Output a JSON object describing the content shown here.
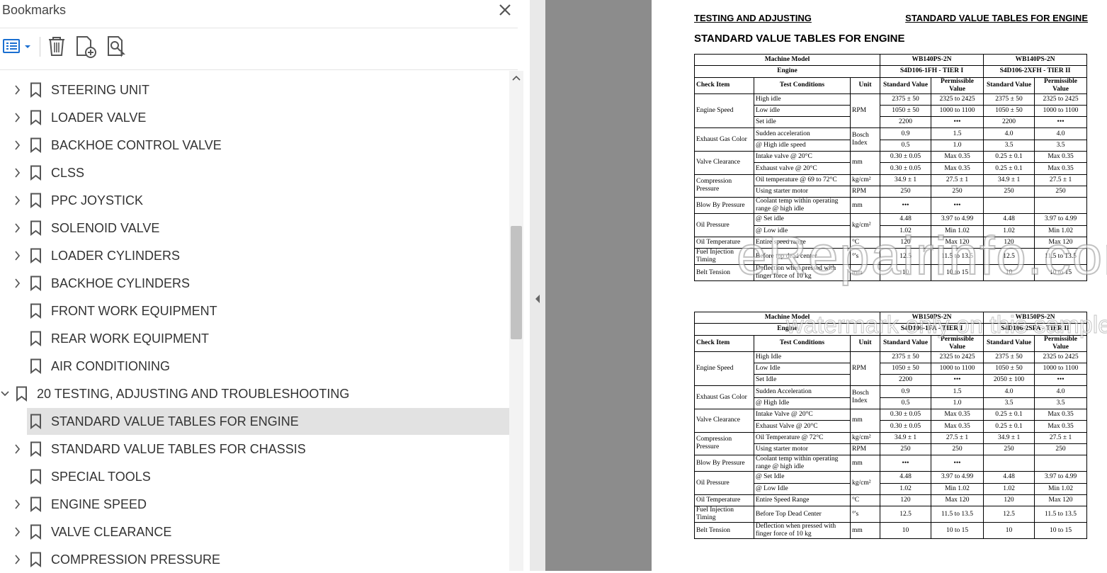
{
  "panel": {
    "title": "Bookmarks"
  },
  "bookmarks": [
    {
      "label": "STEERING UNIT",
      "expandable": true
    },
    {
      "label": "LOADER VALVE",
      "expandable": true
    },
    {
      "label": "BACKHOE CONTROL VALVE",
      "expandable": true
    },
    {
      "label": "CLSS",
      "expandable": true
    },
    {
      "label": "PPC JOYSTICK",
      "expandable": true
    },
    {
      "label": "SOLENOID VALVE",
      "expandable": true
    },
    {
      "label": "LOADER CYLINDERS",
      "expandable": true
    },
    {
      "label": "BACKHOE CYLINDERS",
      "expandable": true
    },
    {
      "label": "FRONT WORK EQUIPMENT",
      "expandable": false
    },
    {
      "label": "REAR WORK EQUIPMENT",
      "expandable": false
    },
    {
      "label": "AIR CONDITIONING",
      "expandable": false
    },
    {
      "label": "20 TESTING, ADJUSTING AND TROUBLESHOOTING",
      "expanded": true
    },
    {
      "label": "STANDARD VALUE TABLES FOR ENGINE",
      "expandable": false,
      "selected": true
    },
    {
      "label": "STANDARD VALUE TABLES FOR CHASSIS",
      "expandable": true
    },
    {
      "label": "SPECIAL TOOLS",
      "expandable": false
    },
    {
      "label": "ENGINE SPEED",
      "expandable": true
    },
    {
      "label": "VALVE CLEARANCE",
      "expandable": true
    },
    {
      "label": "COMPRESSION PRESSURE",
      "expandable": true
    }
  ],
  "page": {
    "header_left": "TESTING AND ADJUSTING",
    "header_right": "STANDARD VALUE TABLES FOR ENGINE",
    "title": "STANDARD VALUE TABLES FOR ENGINE",
    "watermark": "eRepairinfo.com",
    "watermark2": "watermark only on this sample"
  },
  "tables": [
    {
      "rows": [
        [
          {
            "t": "Machine Model",
            "cs": 3,
            "cls": "c b"
          },
          {
            "t": "WB140PS-2N",
            "cs": 2,
            "cls": "c b"
          },
          {
            "t": "WB140PS-2N",
            "cs": 2,
            "cls": "c b"
          }
        ],
        [
          {
            "t": "Engine",
            "cs": 3,
            "cls": "c b"
          },
          {
            "t": "S4D106-1FH - TIER I",
            "cs": 2,
            "cls": "c b"
          },
          {
            "t": "S4D106-2XFH - TIER II",
            "cs": 2,
            "cls": "c b"
          }
        ],
        [
          {
            "t": "Check Item",
            "cls": "b"
          },
          {
            "t": "Test Conditions",
            "cls": "c b"
          },
          {
            "t": "Unit",
            "cls": "c b"
          },
          {
            "t": "Standard Value",
            "cls": "c b"
          },
          {
            "t": "Permissible Value",
            "cls": "c b"
          },
          {
            "t": "Standard Value",
            "cls": "c b"
          },
          {
            "t": "Permissible Value",
            "cls": "c b"
          }
        ],
        [
          {
            "t": "Engine Speed",
            "rs": 3
          },
          {
            "t": "High idle"
          },
          {
            "t": "RPM",
            "rs": 3
          },
          {
            "t": "2375 ± 50",
            "cls": "c"
          },
          {
            "t": "2325 to 2425",
            "cls": "c"
          },
          {
            "t": "2375 ± 50",
            "cls": "c"
          },
          {
            "t": "2325 to 2425",
            "cls": "c"
          }
        ],
        [
          {
            "t": "Low idle"
          },
          {
            "t": "1050 ± 50",
            "cls": "c"
          },
          {
            "t": "1000 to 1100",
            "cls": "c"
          },
          {
            "t": "1050 ± 50",
            "cls": "c"
          },
          {
            "t": "1000 to 1100",
            "cls": "c"
          }
        ],
        [
          {
            "t": "Set idle"
          },
          {
            "t": "2200",
            "cls": "c"
          },
          {
            "t": "•••",
            "cls": "c"
          },
          {
            "t": "2200",
            "cls": "c"
          },
          {
            "t": "•••",
            "cls": "c"
          }
        ],
        [
          {
            "t": "Exhaust Gas Color",
            "rs": 2
          },
          {
            "t": "Sudden acceleration"
          },
          {
            "t": "Bosch Index",
            "rs": 2
          },
          {
            "t": "0.9",
            "cls": "c"
          },
          {
            "t": "1.5",
            "cls": "c"
          },
          {
            "t": "4.0",
            "cls": "c"
          },
          {
            "t": "4.0",
            "cls": "c"
          }
        ],
        [
          {
            "t": "@ High idle speed"
          },
          {
            "t": "0.5",
            "cls": "c"
          },
          {
            "t": "1.0",
            "cls": "c"
          },
          {
            "t": "3.5",
            "cls": "c"
          },
          {
            "t": "3.5",
            "cls": "c"
          }
        ],
        [
          {
            "t": "Valve Clearance",
            "rs": 2
          },
          {
            "t": "Intake valve @ 20°C"
          },
          {
            "t": "mm",
            "rs": 2
          },
          {
            "t": "0.30 ± 0.05",
            "cls": "c"
          },
          {
            "t": "Max 0.35",
            "cls": "c"
          },
          {
            "t": "0.25 ± 0.1",
            "cls": "c"
          },
          {
            "t": "Max 0.35",
            "cls": "c"
          }
        ],
        [
          {
            "t": "Exhaust valve @ 20°C"
          },
          {
            "t": "0.30 ± 0.05",
            "cls": "c"
          },
          {
            "t": "Max 0.35",
            "cls": "c"
          },
          {
            "t": "0.25 ± 0.1",
            "cls": "c"
          },
          {
            "t": "Max 0.35",
            "cls": "c"
          }
        ],
        [
          {
            "t": "Compression Pressure",
            "rs": 2
          },
          {
            "t": "Oil temperature @ 69 to 72°C"
          },
          {
            "t": "kg/cm²"
          },
          {
            "t": "34.9 ± 1",
            "cls": "c"
          },
          {
            "t": "27.5 ± 1",
            "cls": "c"
          },
          {
            "t": "34.9 ± 1",
            "cls": "c"
          },
          {
            "t": "27.5 ± 1",
            "cls": "c"
          }
        ],
        [
          {
            "t": "Using starter motor"
          },
          {
            "t": "RPM"
          },
          {
            "t": "250",
            "cls": "c"
          },
          {
            "t": "250",
            "cls": "c"
          },
          {
            "t": "250",
            "cls": "c"
          },
          {
            "t": "250",
            "cls": "c"
          }
        ],
        [
          {
            "t": "Blow By Pressure"
          },
          {
            "t": "Coolant temp within operating range @ high idle"
          },
          {
            "t": "mm"
          },
          {
            "t": "•••",
            "cls": "c"
          },
          {
            "t": "•••",
            "cls": "c"
          },
          {
            "t": "",
            "cls": "c"
          },
          {
            "t": "",
            "cls": "c"
          }
        ],
        [
          {
            "t": "Oil Pressure",
            "rs": 2
          },
          {
            "t": "@ Set idle"
          },
          {
            "t": "kg/cm²",
            "rs": 2
          },
          {
            "t": "4.48",
            "cls": "c"
          },
          {
            "t": "3.97 to 4.99",
            "cls": "c"
          },
          {
            "t": "4.48",
            "cls": "c"
          },
          {
            "t": "3.97 to 4.99",
            "cls": "c"
          }
        ],
        [
          {
            "t": "@ Low idle"
          },
          {
            "t": "1.02",
            "cls": "c"
          },
          {
            "t": "Min 1.02",
            "cls": "c"
          },
          {
            "t": "1.02",
            "cls": "c"
          },
          {
            "t": "Min 1.02",
            "cls": "c"
          }
        ],
        [
          {
            "t": "Oil Temperature"
          },
          {
            "t": "Entire speed range"
          },
          {
            "t": "°C"
          },
          {
            "t": "120",
            "cls": "c"
          },
          {
            "t": "Max 120",
            "cls": "c"
          },
          {
            "t": "120",
            "cls": "c"
          },
          {
            "t": "Max 120",
            "cls": "c"
          }
        ],
        [
          {
            "t": "Fuel Injection Timing"
          },
          {
            "t": "Before top dead center"
          },
          {
            "t": "°'s"
          },
          {
            "t": "12.5",
            "cls": "c"
          },
          {
            "t": "11.5 to 13.5",
            "cls": "c"
          },
          {
            "t": "12.5",
            "cls": "c"
          },
          {
            "t": "11.5 to 13.5",
            "cls": "c"
          }
        ],
        [
          {
            "t": "Belt Tension"
          },
          {
            "t": "Deflection when pressed with finger force of 10 kg"
          },
          {
            "t": "mm"
          },
          {
            "t": "10",
            "cls": "c"
          },
          {
            "t": "10 to 15",
            "cls": "c"
          },
          {
            "t": "10",
            "cls": "c"
          },
          {
            "t": "10 to 15",
            "cls": "c"
          }
        ]
      ]
    },
    {
      "rows": [
        [
          {
            "t": "Machine Model",
            "cs": 3,
            "cls": "c b"
          },
          {
            "t": "WB150PS-2N",
            "cs": 2,
            "cls": "c b"
          },
          {
            "t": "WB150PS-2N",
            "cs": 2,
            "cls": "c b"
          }
        ],
        [
          {
            "t": "Engine",
            "cs": 3,
            "cls": "c b"
          },
          {
            "t": "S4D106-1FA - TIER I",
            "cs": 2,
            "cls": "c b"
          },
          {
            "t": "S4D106-2SFA - TIER II",
            "cs": 2,
            "cls": "c b"
          }
        ],
        [
          {
            "t": "Check Item",
            "cls": "b"
          },
          {
            "t": "Test Conditions",
            "cls": "c b"
          },
          {
            "t": "Unit",
            "cls": "c b"
          },
          {
            "t": "Standard Value",
            "cls": "c b"
          },
          {
            "t": "Permissible Value",
            "cls": "c b"
          },
          {
            "t": "Standard Value",
            "cls": "c b"
          },
          {
            "t": "Permissible Value",
            "cls": "c b"
          }
        ],
        [
          {
            "t": "Engine Speed",
            "rs": 3
          },
          {
            "t": "High Idle"
          },
          {
            "t": "RPM",
            "rs": 3
          },
          {
            "t": "2375 ± 50",
            "cls": "c"
          },
          {
            "t": "2325 to 2425",
            "cls": "c"
          },
          {
            "t": "2375 ± 50",
            "cls": "c"
          },
          {
            "t": "2325 to 2425",
            "cls": "c"
          }
        ],
        [
          {
            "t": "Low Idle"
          },
          {
            "t": "1050 ± 50",
            "cls": "c"
          },
          {
            "t": "1000 to 1100",
            "cls": "c"
          },
          {
            "t": "1050 ± 50",
            "cls": "c"
          },
          {
            "t": "1000 to 1100",
            "cls": "c"
          }
        ],
        [
          {
            "t": "Set Idle"
          },
          {
            "t": "2200",
            "cls": "c"
          },
          {
            "t": "•••",
            "cls": "c"
          },
          {
            "t": "2050 ± 100",
            "cls": "c"
          },
          {
            "t": "•••",
            "cls": "c"
          }
        ],
        [
          {
            "t": "Exhaust Gas Color",
            "rs": 2
          },
          {
            "t": "Sudden Acceleration"
          },
          {
            "t": "Bosch Index",
            "rs": 2
          },
          {
            "t": "0.9",
            "cls": "c"
          },
          {
            "t": "1.5",
            "cls": "c"
          },
          {
            "t": "4.0",
            "cls": "c"
          },
          {
            "t": "4.0",
            "cls": "c"
          }
        ],
        [
          {
            "t": "@ High Idle"
          },
          {
            "t": "0.5",
            "cls": "c"
          },
          {
            "t": "1.0",
            "cls": "c"
          },
          {
            "t": "3.5",
            "cls": "c"
          },
          {
            "t": "3.5",
            "cls": "c"
          }
        ],
        [
          {
            "t": "Valve Clearance",
            "rs": 2
          },
          {
            "t": "Intake Valve @ 20°C"
          },
          {
            "t": "mm",
            "rs": 2
          },
          {
            "t": "0.30 ± 0.05",
            "cls": "c"
          },
          {
            "t": "Max 0.35",
            "cls": "c"
          },
          {
            "t": "0.25 ± 0.1",
            "cls": "c"
          },
          {
            "t": "Max 0.35",
            "cls": "c"
          }
        ],
        [
          {
            "t": "Exhaust Valve @ 20°C"
          },
          {
            "t": "0.30 ± 0.05",
            "cls": "c"
          },
          {
            "t": "Max 0.35",
            "cls": "c"
          },
          {
            "t": "0.25 ± 0.1",
            "cls": "c"
          },
          {
            "t": "Max 0.35",
            "cls": "c"
          }
        ],
        [
          {
            "t": "Compression Pressure",
            "rs": 2
          },
          {
            "t": "Oil Temperature @ 72°C"
          },
          {
            "t": "kg/cm²"
          },
          {
            "t": "34.9 ± 1",
            "cls": "c"
          },
          {
            "t": "27.5 ± 1",
            "cls": "c"
          },
          {
            "t": "34.9 ± 1",
            "cls": "c"
          },
          {
            "t": "27.5 ± 1",
            "cls": "c"
          }
        ],
        [
          {
            "t": "Using starter motor"
          },
          {
            "t": "RPM"
          },
          {
            "t": "250",
            "cls": "c"
          },
          {
            "t": "250",
            "cls": "c"
          },
          {
            "t": "250",
            "cls": "c"
          },
          {
            "t": "250",
            "cls": "c"
          }
        ],
        [
          {
            "t": "Blow By Pressure"
          },
          {
            "t": "Coolant temp within operating range @ high idle"
          },
          {
            "t": "mm"
          },
          {
            "t": "•••",
            "cls": "c"
          },
          {
            "t": "•••",
            "cls": "c"
          },
          {
            "t": "",
            "cls": "c"
          },
          {
            "t": "",
            "cls": "c"
          }
        ],
        [
          {
            "t": "Oil Pressure",
            "rs": 2
          },
          {
            "t": "@ Set Idle"
          },
          {
            "t": "kg/cm²",
            "rs": 2
          },
          {
            "t": "4.48",
            "cls": "c"
          },
          {
            "t": "3.97 to 4.99",
            "cls": "c"
          },
          {
            "t": "4.48",
            "cls": "c"
          },
          {
            "t": "3.97 to 4.99",
            "cls": "c"
          }
        ],
        [
          {
            "t": "@ Low Idle"
          },
          {
            "t": "1.02",
            "cls": "c"
          },
          {
            "t": "Min 1.02",
            "cls": "c"
          },
          {
            "t": "1.02",
            "cls": "c"
          },
          {
            "t": "Min 1.02",
            "cls": "c"
          }
        ],
        [
          {
            "t": "Oil Temperature"
          },
          {
            "t": "Entire Speed Range"
          },
          {
            "t": "°C"
          },
          {
            "t": "120",
            "cls": "c"
          },
          {
            "t": "Max 120",
            "cls": "c"
          },
          {
            "t": "120",
            "cls": "c"
          },
          {
            "t": "Max 120",
            "cls": "c"
          }
        ],
        [
          {
            "t": "Fuel Injection Timing"
          },
          {
            "t": "Before Top Dead Center"
          },
          {
            "t": "°'s"
          },
          {
            "t": "12.5",
            "cls": "c"
          },
          {
            "t": "11.5 to 13.5",
            "cls": "c"
          },
          {
            "t": "12.5",
            "cls": "c"
          },
          {
            "t": "11.5 to 13.5",
            "cls": "c"
          }
        ],
        [
          {
            "t": "Belt Tension"
          },
          {
            "t": "Deflection when pressed with finger force of 10 kg"
          },
          {
            "t": "mm"
          },
          {
            "t": "10",
            "cls": "c"
          },
          {
            "t": "10 to 15",
            "cls": "c"
          },
          {
            "t": "10",
            "cls": "c"
          },
          {
            "t": "10 to 15",
            "cls": "c"
          }
        ]
      ]
    }
  ]
}
